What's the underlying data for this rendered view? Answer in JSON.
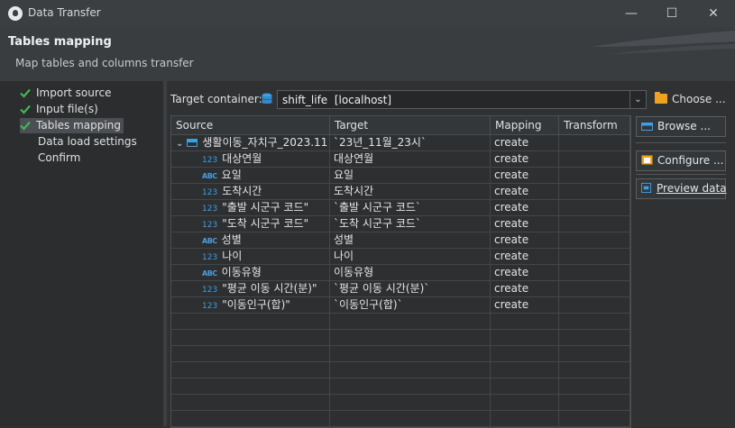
{
  "window": {
    "title": "Data Transfer",
    "minimize": "—",
    "maximize": "☐",
    "close": "✕"
  },
  "header": {
    "title": "Tables mapping",
    "subtitle": "Map tables and columns transfer"
  },
  "nav": [
    {
      "label": "Import source",
      "done": true
    },
    {
      "label": "Input file(s)",
      "done": true
    },
    {
      "label": "Tables mapping",
      "done": true,
      "active": true
    },
    {
      "label": "Data load settings",
      "done": false
    },
    {
      "label": "Confirm",
      "done": false
    }
  ],
  "target": {
    "label": "Target container:",
    "value": "shift_life  [localhost]",
    "choose_label": "Choose ..."
  },
  "table": {
    "columns": [
      "Source",
      "Target",
      "Mapping",
      "Transform"
    ],
    "parent": {
      "source": "생활이동_자치구_2023.11",
      "target": "`23년_11월_23시`",
      "mapping": "create",
      "transform": ""
    },
    "rows": [
      {
        "type": "123",
        "source": "대상연월",
        "target": "대상연월",
        "mapping": "create"
      },
      {
        "type": "ABC",
        "source": "요일",
        "target": "요일",
        "mapping": "create"
      },
      {
        "type": "123",
        "source": "도착시간",
        "target": "도착시간",
        "mapping": "create"
      },
      {
        "type": "123",
        "source": "\"출발 시군구 코드\"",
        "target": "`출발 시군구 코드`",
        "mapping": "create"
      },
      {
        "type": "123",
        "source": "\"도착 시군구 코드\"",
        "target": "`도착 시군구 코드`",
        "mapping": "create"
      },
      {
        "type": "ABC",
        "source": "성별",
        "target": "성별",
        "mapping": "create"
      },
      {
        "type": "123",
        "source": "나이",
        "target": "나이",
        "mapping": "create"
      },
      {
        "type": "ABC",
        "source": "이동유형",
        "target": "이동유형",
        "mapping": "create"
      },
      {
        "type": "123",
        "source": "\"평균 이동 시간(분)\"",
        "target": "`평균 이동 시간(분)`",
        "mapping": "create"
      },
      {
        "type": "123",
        "source": "\"이동인구(합)\"",
        "target": "`이동인구(합)`",
        "mapping": "create"
      }
    ]
  },
  "buttons": {
    "browse": "Browse ...",
    "configure": "Configure ...",
    "preview": "Preview data"
  },
  "colors": {
    "accent_blue": "#3aa0e8",
    "check_green": "#3fb950",
    "folder_orange": "#f0a41c"
  }
}
